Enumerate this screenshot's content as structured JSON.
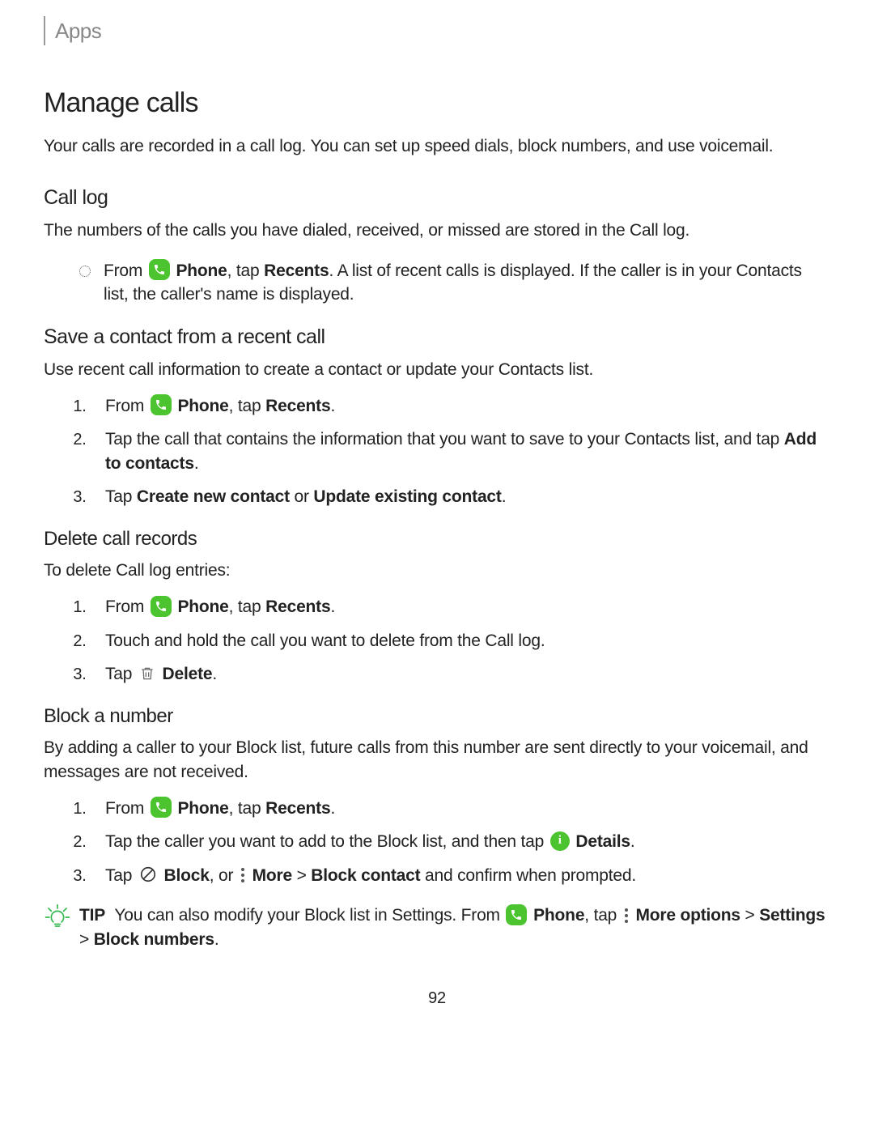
{
  "breadcrumb": "Apps",
  "h1": "Manage calls",
  "intro": "Your calls are recorded in a call log. You can set up speed dials, block numbers, and use voicemail.",
  "call_log": {
    "title": "Call log",
    "desc": "The numbers of the calls you have dialed, received, or missed are stored in the Call log.",
    "bullet": {
      "pre": "From ",
      "phone": "Phone",
      "mid1": ", tap ",
      "recents": "Recents",
      "post": ". A list of recent calls is displayed. If the caller is in your Contacts list, the caller's name is displayed."
    }
  },
  "save_contact": {
    "title": "Save a contact from a recent call",
    "desc": "Use recent call information to create a contact or update your Contacts list.",
    "s1": {
      "pre": "From ",
      "phone": "Phone",
      "mid": ", tap ",
      "recents": "Recents",
      "post": "."
    },
    "s2": {
      "pre": "Tap the call that contains the information that you want to save to your Contacts list, and tap ",
      "b": "Add to contacts",
      "post": "."
    },
    "s3": {
      "pre": "Tap ",
      "b1": "Create new contact",
      "mid": " or ",
      "b2": "Update existing contact",
      "post": "."
    }
  },
  "delete_records": {
    "title": "Delete call records",
    "desc": "To delete Call log entries:",
    "s1": {
      "pre": "From ",
      "phone": "Phone",
      "mid": ", tap ",
      "recents": "Recents",
      "post": "."
    },
    "s2": "Touch and hold the call you want to delete from the Call log.",
    "s3": {
      "pre": "Tap ",
      "b": "Delete",
      "post": "."
    }
  },
  "block_number": {
    "title": "Block a number",
    "desc": "By adding a caller to your Block list, future calls from this number are sent directly to your voicemail, and messages are not received.",
    "s1": {
      "pre": "From ",
      "phone": "Phone",
      "mid": ", tap ",
      "recents": "Recents",
      "post": "."
    },
    "s2": {
      "pre": "Tap the caller you want to add to the Block list, and then tap ",
      "b": "Details",
      "post": "."
    },
    "s3": {
      "pre": "Tap ",
      "b1": "Block",
      "mid1": ", or ",
      "b2": "More",
      "mid2": " > ",
      "b3": "Block contact",
      "post": " and confirm when prompted."
    }
  },
  "tip": {
    "label": "TIP",
    "pre": "You can also modify your Block list in Settings. From ",
    "phone": "Phone",
    "mid1": ", tap ",
    "b1": "More options",
    "mid2": " > ",
    "b2": "Settings",
    "mid3": " > ",
    "b3": "Block numbers",
    "post": "."
  },
  "page_number": "92"
}
